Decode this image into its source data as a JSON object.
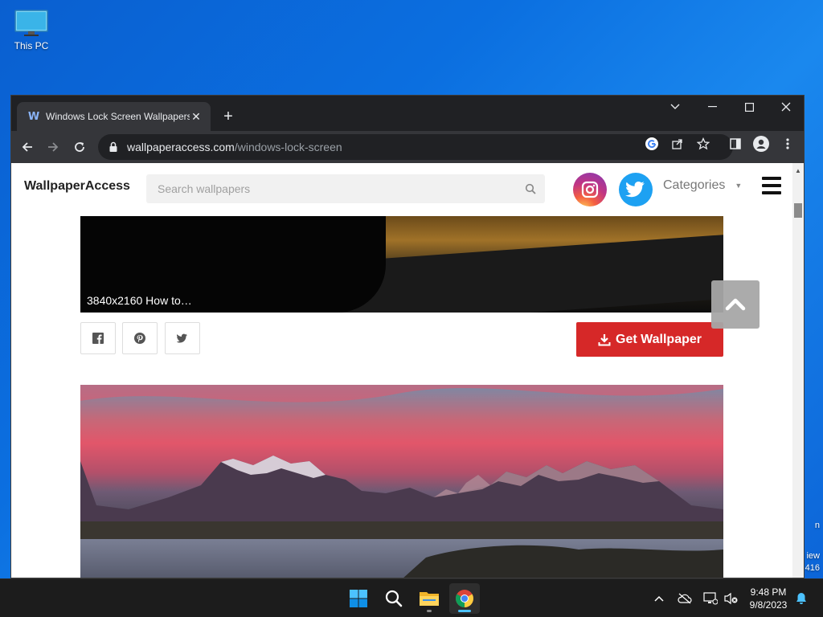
{
  "desktop": {
    "this_pc_label": "This PC",
    "edge_text_1": "n",
    "edge_text_2": "iew",
    "edge_text_3": "416"
  },
  "browser": {
    "tab_favicon": "W",
    "tab_title": "Windows Lock Screen Wallpapers",
    "url_host": "wallpaperaccess.com",
    "url_path": "/windows-lock-screen"
  },
  "site": {
    "logo": "WallpaperAccess",
    "search_placeholder": "Search wallpapers",
    "categories_label": "Categories",
    "card1_resolution": "3840x2160 How to…",
    "get_wallpaper_label": "Get Wallpaper"
  },
  "colors": {
    "download_button": "#d62828",
    "chrome_dark": "#202124",
    "chrome_toolbar": "#35363a",
    "desktop_blue": "#0b6fe0"
  },
  "taskbar": {
    "time": "9:48 PM",
    "date": "9/8/2023"
  }
}
